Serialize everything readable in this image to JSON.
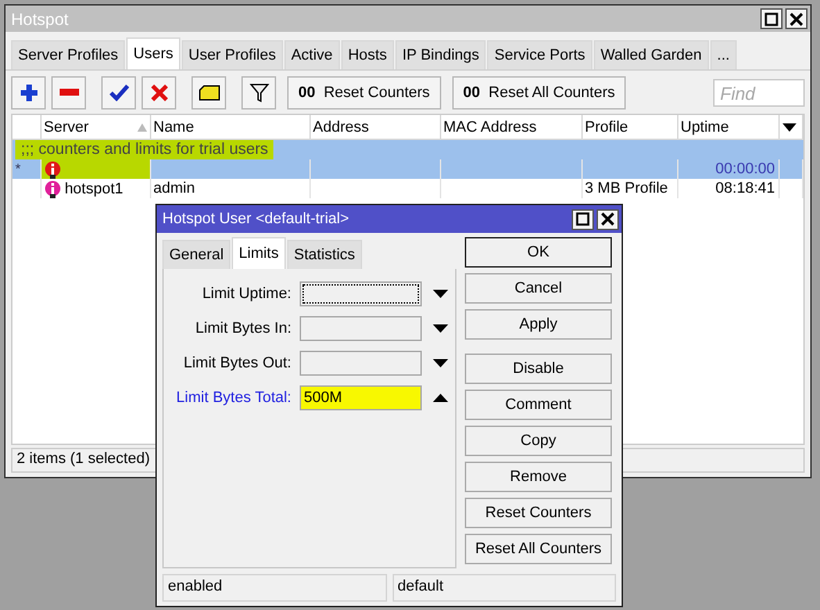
{
  "window": {
    "title": "Hotspot"
  },
  "tabs": [
    {
      "label": "Server Profiles",
      "selected": false
    },
    {
      "label": "Users",
      "selected": true
    },
    {
      "label": "User Profiles",
      "selected": false
    },
    {
      "label": "Active",
      "selected": false
    },
    {
      "label": "Hosts",
      "selected": false
    },
    {
      "label": "IP Bindings",
      "selected": false
    },
    {
      "label": "Service Ports",
      "selected": false
    },
    {
      "label": "Walled Garden",
      "selected": false
    },
    {
      "label": "...",
      "selected": false
    }
  ],
  "toolbar": {
    "icon_buttons": [
      {
        "kind": "add"
      },
      {
        "kind": "remove"
      },
      {
        "kind": "enable"
      },
      {
        "kind": "disable"
      },
      {
        "kind": "comment"
      },
      {
        "kind": "filter"
      }
    ],
    "text_buttons": [
      {
        "glyph": "00",
        "label": "Reset Counters"
      },
      {
        "glyph": "00",
        "label": "Reset All Counters"
      }
    ],
    "search": {
      "placeholder": "Find"
    }
  },
  "table": {
    "columns": [
      {
        "label": "Server",
        "sorted": true
      },
      {
        "label": "Name",
        "sorted": false
      },
      {
        "label": "Address",
        "sorted": false
      },
      {
        "label": "MAC Address",
        "sorted": false
      },
      {
        "label": "Profile",
        "sorted": false
      },
      {
        "label": "Uptime",
        "sorted": false
      }
    ],
    "rows": [
      {
        "kind": "comment",
        "text": ";;; counters and limits for trial users",
        "selected": true,
        "highlighted": true
      },
      {
        "kind": "user",
        "marker": "*",
        "color": "#e01818",
        "cells": [
          "",
          "",
          "",
          "",
          "",
          "00:00:00"
        ],
        "selected": true,
        "highlighted": true
      },
      {
        "kind": "user",
        "marker": "",
        "color": "#e0209a",
        "cells": [
          "hotspot1",
          "admin",
          "",
          "",
          "3 MB Profile",
          "08:18:41"
        ],
        "selected": false,
        "highlighted": false
      }
    ]
  },
  "status_bar": "2 items (1 selected)",
  "dialog": {
    "title": "Hotspot User <default-trial>",
    "tabs": [
      {
        "label": "General",
        "selected": false
      },
      {
        "label": "Limits",
        "selected": true
      },
      {
        "label": "Statistics",
        "selected": false
      }
    ],
    "fields": [
      {
        "label": "Limit Uptime:",
        "focused": true,
        "expanded": false,
        "highlighted": false
      },
      {
        "label": "Limit Bytes In:",
        "focused": false,
        "expanded": false,
        "highlighted": false
      },
      {
        "label": "Limit Bytes Out:",
        "focused": false,
        "expanded": false,
        "highlighted": false
      },
      {
        "label": "Limit Bytes Total:",
        "value": "500M",
        "focused": false,
        "expanded": true,
        "highlighted": true
      }
    ],
    "button_groups": [
      {
        "buttons": [
          {
            "label": "OK",
            "default": true
          },
          {
            "label": "Cancel",
            "default": false
          },
          {
            "label": "Apply",
            "default": false
          }
        ]
      },
      {
        "buttons": [
          {
            "label": "Disable",
            "default": false
          },
          {
            "label": "Comment",
            "default": false
          },
          {
            "label": "Copy",
            "default": false
          },
          {
            "label": "Remove",
            "default": false
          },
          {
            "label": "Reset Counters",
            "default": false
          },
          {
            "label": "Reset All Counters",
            "default": false
          }
        ]
      }
    ],
    "status": [
      "enabled",
      "default"
    ]
  }
}
